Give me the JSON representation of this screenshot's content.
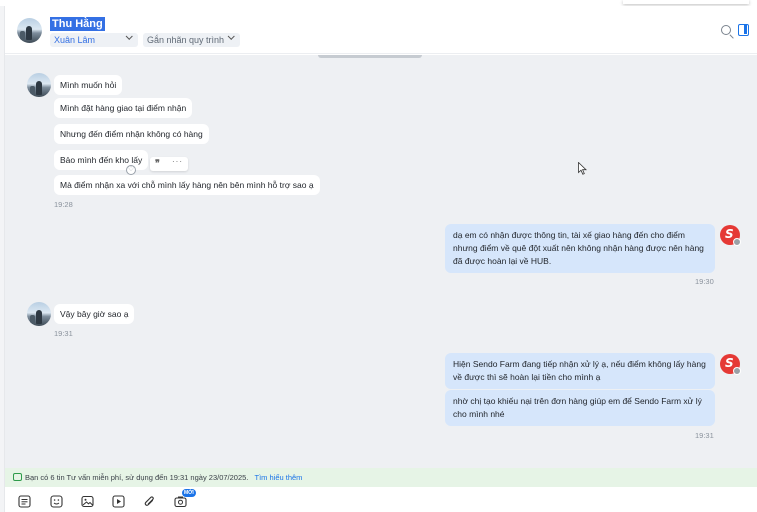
{
  "header": {
    "contact_name": "Thu Hằng",
    "assignee": "Xuân Lâm",
    "label_placeholder": "Gắn nhãn quy trình"
  },
  "messages": {
    "in1": [
      "Mình muốn hỏi",
      "Mình đặt hàng giao tại điểm nhận",
      "Nhưng đến điểm nhận không có hàng",
      "Bảo mình đến kho lấy",
      "Mà điểm nhận xa với chỗ mình lấy hàng nên bên mình hỗ trợ sao ạ"
    ],
    "in1_time": "19:28",
    "out1": "dạ em có nhận được thông tin, tài xế giao hàng đến cho điểm nhưng điểm về quê đột xuất nên không nhận hàng được nên hàng đã được hoàn lại về HUB.",
    "out1_time": "19:30",
    "in2": "Vậy bây giờ sao ạ",
    "in2_time": "19:31",
    "out2a": "Hiện Sendo Farm đang tiếp nhận xử lý ạ, nếu điểm không lấy hàng về được thì sẽ hoàn lại tiền cho mình ạ",
    "out2b": "nhờ chị tạo khiếu nại trên đơn hàng giúp em để Sendo Farm xử lý cho mình nhé",
    "out2_time": "19:31"
  },
  "reaction": {
    "quote_glyph": "❞",
    "more_glyph": "···"
  },
  "infobar": {
    "text": "Bạn có 6 tin Tư vấn miễn phí, sử dụng đến 19:31 ngày 23/07/2025.",
    "link": "Tìm hiểu thêm"
  },
  "toolbar": {
    "new_badge": "MỚI",
    "icons": [
      "template-icon",
      "sticker-icon",
      "image-icon",
      "video-icon",
      "attachment-icon",
      "camera-icon"
    ]
  },
  "colors": {
    "accent": "#1a73e8",
    "incoming_bubble": "#ffffff",
    "outgoing_bubble": "#d6e6fb",
    "conversation_bg": "#eef0f3",
    "sendo_red": "#e53935"
  }
}
